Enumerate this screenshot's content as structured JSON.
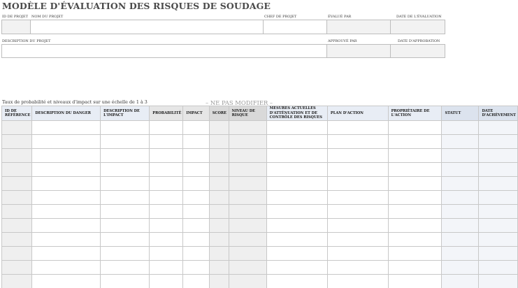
{
  "title": "MODÈLE D'ÉVALUATION DES RISQUES DE SOUDAGE",
  "project_fields": {
    "project_id": "ID DE PROJET",
    "project_name": "NOM DU PROJET",
    "project_manager": "CHEF DE PROJET",
    "evaluated_by": "ÉVALUÉ PAR",
    "evaluation_date": "DATE DE L'ÉVALUATION",
    "project_description": "DESCRIPTION DU PROJET",
    "approved_by": "APPROUVÉ PAR",
    "approval_date": "DATE D'APPROBATION"
  },
  "scale_note": "Taux de probabilité et niveaux d'impact sur une échelle de 1 à 3",
  "do_not_modify": "– NE PAS MODIFIER –",
  "table": {
    "headers": [
      "ID DE RÉFÉRENCE",
      "DESCRIPTION DU DANGER",
      "DESCRIPTION DE L'IMPACT",
      "PROBABILITÉ",
      "IMPACT",
      "SCORE",
      "NIVEAU DE RISQUE",
      "MESURES ACTUELLES D'ATTÉNUATION ET DE CONTRÔLE DES RISQUES",
      "PLAN D'ACTION",
      "PROPRIÉTAIRE DE L'ACTION",
      "STATUT",
      "DATE D'ACHÈVEMENT"
    ],
    "row_count": 12
  }
}
